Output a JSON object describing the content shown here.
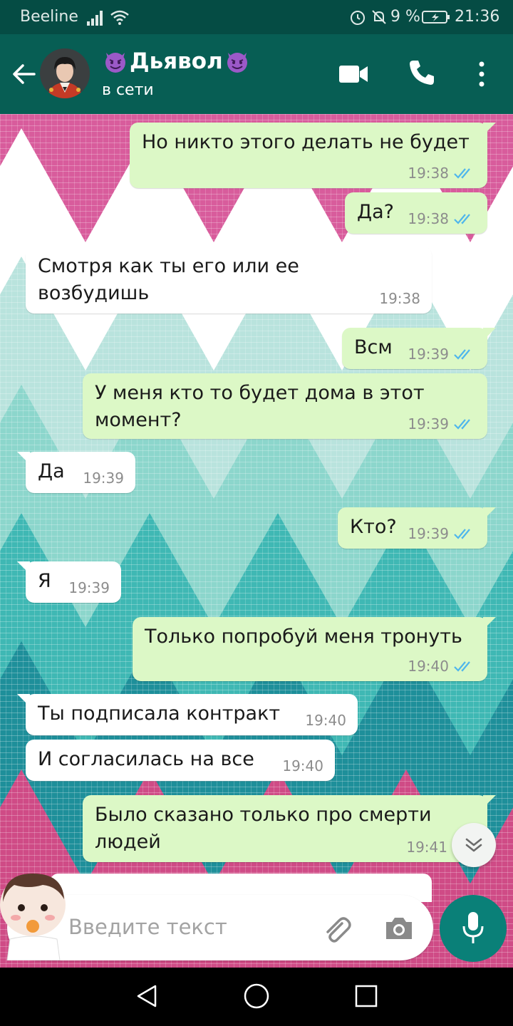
{
  "status_bar": {
    "carrier": "Beeline",
    "battery_percent": "9 %",
    "time": "21:36"
  },
  "header": {
    "contact_name": "Дьявол",
    "contact_status": "в сети",
    "name_emoji": "smiling-devil-icon"
  },
  "messages": [
    {
      "dir": "out",
      "text": "Но никто этого делать не будет",
      "time": "19:38",
      "read": true
    },
    {
      "dir": "out",
      "text": "Да?",
      "time": "19:38",
      "read": true
    },
    {
      "dir": "in",
      "text": "Смотря как ты его или ее\nвозбудишь",
      "time": "19:38"
    },
    {
      "dir": "out",
      "text": "Всм",
      "time": "19:39",
      "read": true
    },
    {
      "dir": "out",
      "text": "У меня кто то будет дома в этот\nмомент?",
      "time": "19:39",
      "read": true
    },
    {
      "dir": "in",
      "text": "Да",
      "time": "19:39"
    },
    {
      "dir": "out",
      "text": "Кто?",
      "time": "19:39",
      "read": true
    },
    {
      "dir": "in",
      "text": "Я",
      "time": "19:39"
    },
    {
      "dir": "out",
      "text": "Только попробуй меня тронуть",
      "time": "19:40",
      "read": true
    },
    {
      "dir": "in",
      "text": "Ты подписала контракт",
      "time": "19:40"
    },
    {
      "dir": "in",
      "text": "И согласилась на все",
      "time": "19:40"
    },
    {
      "dir": "out",
      "text": "Было сказано только про смерти\nлюдей",
      "time": "19:41",
      "read": true
    }
  ],
  "composer": {
    "placeholder": "Введите текст",
    "value": ""
  },
  "colors": {
    "header": "#075e54",
    "status_bar": "#054c44",
    "outgoing_bubble": "#dcf8c6",
    "incoming_bubble": "#ffffff",
    "read_ticks": "#4fb6ec",
    "mic_button": "#0a8078"
  }
}
